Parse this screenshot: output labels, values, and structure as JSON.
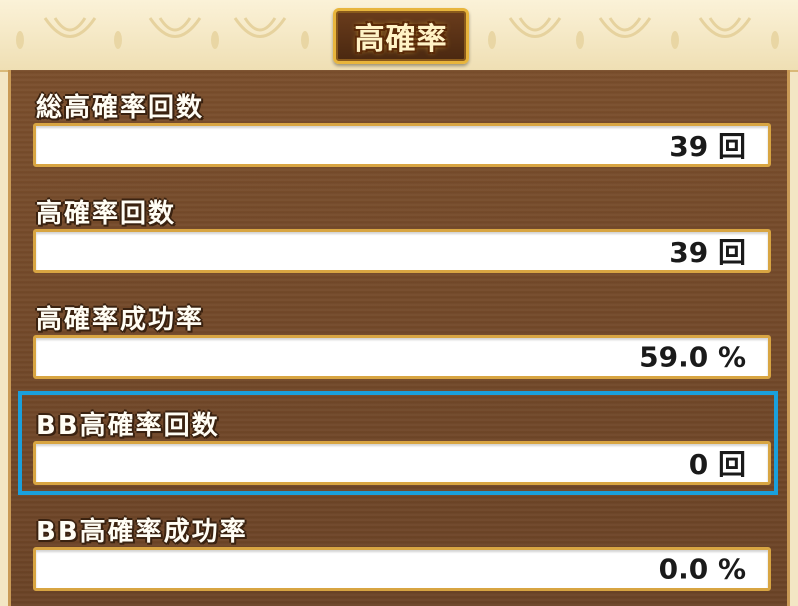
{
  "header": {
    "title": "高確率"
  },
  "stats": [
    {
      "label": "総高確率回数",
      "value": "39 回"
    },
    {
      "label": "高確率回数",
      "value": "39 回"
    },
    {
      "label": "高確率成功率",
      "value": "59.0 %"
    },
    {
      "label": "BB高確率回数",
      "value": "0 回"
    },
    {
      "label": "BB高確率成功率",
      "value": "0.0 %"
    }
  ],
  "colors": {
    "accent_gold": "#e8b53c",
    "panel_brown": "#7a4e2c",
    "highlight": "#1aa0dc"
  }
}
